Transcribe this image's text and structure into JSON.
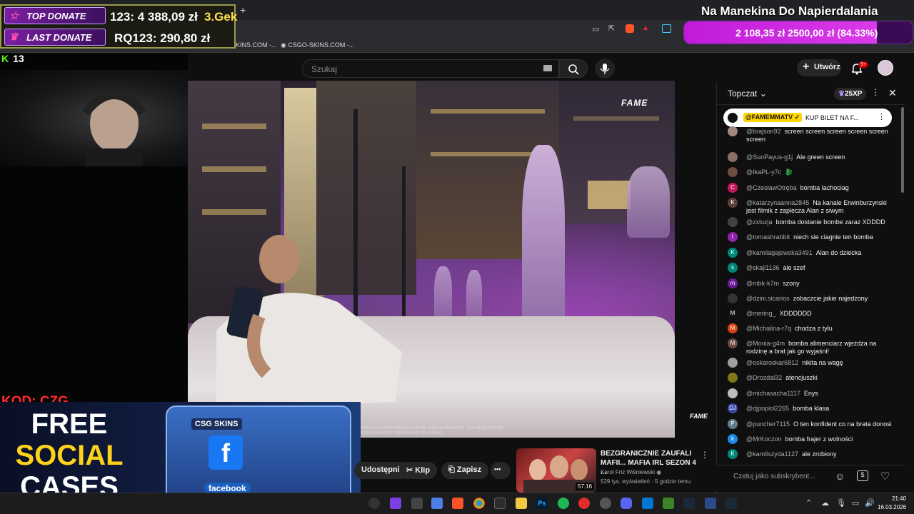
{
  "browser": {
    "new_tab": "+",
    "bookmarks": [
      "KINS.COM -...",
      "CSGO-SKINS.COM -..."
    ]
  },
  "youtube": {
    "search_placeholder": "Szukaj",
    "create_label": "Utwórz",
    "notifications_badge": "9+"
  },
  "overlay": {
    "top_donate_label": "TOP DONATE",
    "top_donate_value": "123: 4 388,09 zł",
    "top_donate_rank": "3.Gek",
    "last_donate_label": "LAST DONATE",
    "last_donate_value": "RQ123: 290,80 zł",
    "viewer_count": "13",
    "stream_title": "Na Manekina Do Napierdalania",
    "goal_text": "2 108,35 zł 2500,00 zł (84.33%)",
    "goal_fraction": 0.8433,
    "code_text": "KOD: CZG",
    "promo_lines": [
      "FREE",
      "SOCIAL",
      "CASES"
    ],
    "promo_chest_label": "CSG SKINS",
    "promo_fb_letter": "f",
    "promo_fb_word": "facebook"
  },
  "video": {
    "watermark": "FAME",
    "watermark_small": "FAME",
    "disclaimer": "ZAKŁADY SĄ DOSTĘPNE NA STRONIE: WWW.SUPERSET.PL · GRA NIESIE RYZYKO PODLEGA KARZE. HAZARD MOŻE UZALEŻNIAĆ."
  },
  "actions": {
    "share_label": "Udostępnij",
    "clip_label": "Klip",
    "save_label": "Zapisz",
    "more_label": "•••"
  },
  "recommended": {
    "title": "BEZGRANICZNIE ZAUFALI MAFII... MAFIA IRL SEZON 4 ...",
    "channel": "Karol Friz Wiśniewski",
    "meta": "529 tys. wyświetleń · 5 godzin temu",
    "duration": "57:16"
  },
  "chat": {
    "header_title": "Topczat ⌄",
    "xp": "25XP",
    "pinned_name": "@FAMEMMATV ✓",
    "pinned_text": "KUP BILET NA F...",
    "input_placeholder": "Czatuj jako subskrybent...",
    "messages": [
      {
        "user": "@brajson92",
        "text": "screen screen screen screen screen screen",
        "avatar": "",
        "color": "#a1887f"
      },
      {
        "user": "@SunPayus-g1j",
        "text": "Ale green screen",
        "avatar": "",
        "color": "#8d6e63"
      },
      {
        "user": "@IkaPL-y7c",
        "text": "🐉",
        "avatar": "",
        "color": "#6d4c41"
      },
      {
        "user": "@CzesławOtręba",
        "text": "bomba lachociag",
        "avatar": "C",
        "color": "#c2185b"
      },
      {
        "user": "@katarzynaanna2845",
        "text": "Na kanale Erwinburzynski jest filmik z zaplecza Alan z siwym",
        "avatar": "K",
        "color": "#5d4037"
      },
      {
        "user": "@zxluzja",
        "text": "bomba dostanie bombe zaraz XDDDD",
        "avatar": "",
        "color": "#424242"
      },
      {
        "user": "@tomashrabbit",
        "text": "niech sie ciagnie ten bomba",
        "avatar": "t",
        "color": "#8e24aa"
      },
      {
        "user": "@kamilagajewska3491",
        "text": "Alan do dziecka",
        "avatar": "K",
        "color": "#00897b"
      },
      {
        "user": "@skajl1136",
        "text": "ale szef",
        "avatar": "s",
        "color": "#00897b"
      },
      {
        "user": "@mbk-k7m",
        "text": "szony",
        "avatar": "m",
        "color": "#6a1b9a"
      },
      {
        "user": "@dzini.sicarios",
        "text": "zobaczcie jakie najedzony",
        "avatar": "",
        "color": "#333333"
      },
      {
        "user": "@mering_",
        "text": "XDDDDDD",
        "avatar": "M",
        "color": "#111111"
      },
      {
        "user": "@Michalina-r7q",
        "text": "chodza z tylu",
        "avatar": "M",
        "color": "#d84315"
      },
      {
        "user": "@Monia-g4m",
        "text": "bomba alimenciarz wjeżdża na rodzinę a brat jak go wyjaśni!",
        "avatar": "M",
        "color": "#6d4c41"
      },
      {
        "user": "@oskaroskar6812",
        "text": "nikita na wagę",
        "avatar": "",
        "color": "#9e9e9e"
      },
      {
        "user": "@Drozdal32",
        "text": "atencjuszki",
        "avatar": "",
        "color": "#827717"
      },
      {
        "user": "@michasacha1117",
        "text": "Enys",
        "avatar": "",
        "color": "#bdbdbd"
      },
      {
        "user": "@djpopiol2265",
        "text": "bomba klasa",
        "avatar": "DJ",
        "color": "#3949ab"
      },
      {
        "user": "@puncher7115",
        "text": "O ten konfident co na brata donosi",
        "avatar": "P",
        "color": "#607d8b"
      },
      {
        "user": "@MrKoczon",
        "text": "bomba frajer z wolności",
        "avatar": "k",
        "color": "#1e88e5"
      },
      {
        "user": "@kamilszyda1127",
        "text": "ale zrobiony",
        "avatar": "K",
        "color": "#00897b"
      }
    ]
  },
  "taskbar": {
    "time": "21:40",
    "date": "16.03.2026"
  }
}
